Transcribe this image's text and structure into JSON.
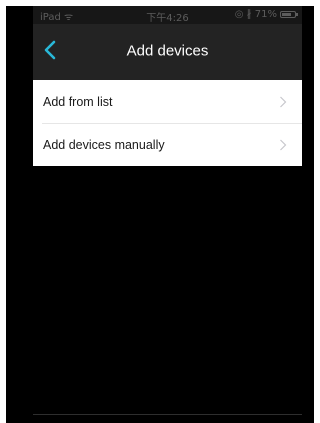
{
  "status_bar": {
    "carrier": "iPad ᯤ",
    "time": "下午4:26",
    "indicators": "◎ ∦ 71%",
    "battery_level": 0.71
  },
  "nav": {
    "title": "Add devices",
    "back_icon": "chevron-left-icon",
    "accent_color": "#29b8d8"
  },
  "list": {
    "items": [
      {
        "label": "Add from list",
        "icon": "chevron-right-icon"
      },
      {
        "label": "Add devices manually",
        "icon": "chevron-right-icon"
      }
    ]
  }
}
